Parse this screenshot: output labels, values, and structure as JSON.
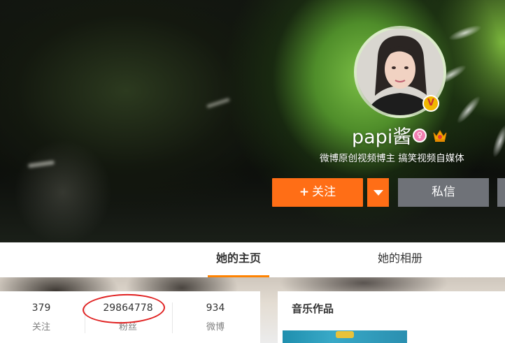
{
  "profile": {
    "name": "papi酱",
    "bio": "微博原创视频博主 搞笑视频自媒体",
    "verified_badge": "V",
    "gender_icon": "female-icon",
    "vip_icon": "crown-icon"
  },
  "actions": {
    "follow_plus": "+",
    "follow_label": "关注",
    "more_icon": "chevron-down-icon",
    "message_label": "私信"
  },
  "tabs": [
    {
      "label": "她的主页",
      "active": true
    },
    {
      "label": "她的相册",
      "active": false
    }
  ],
  "stats": [
    {
      "value": "379",
      "label": "关注"
    },
    {
      "value": "29864778",
      "label": "粉丝"
    },
    {
      "value": "934",
      "label": "微博"
    }
  ],
  "music": {
    "title": "音乐作品"
  },
  "colors": {
    "accent": "#ff6e16",
    "tab_underline": "#ff8200",
    "message_btn": "#6f7278",
    "annotation": "#e02020"
  }
}
